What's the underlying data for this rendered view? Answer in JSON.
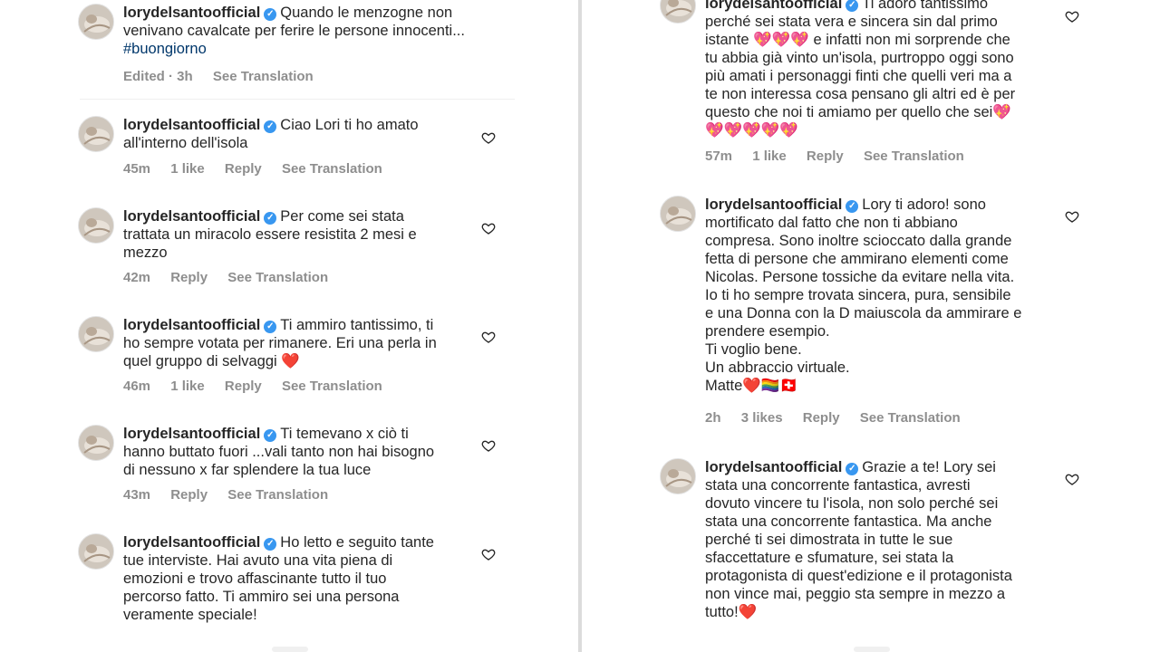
{
  "left": {
    "caption": {
      "username": "lorydelsantoofficial",
      "text": "Quando le menzogne non venivano cavalcate per ferire le persone innocenti...",
      "hashtag": "#buongiorno",
      "edited": "Edited · 3h",
      "translate": "See Translation"
    },
    "comments": [
      {
        "username": "lorydelsantoofficial",
        "line1": "Ciao Lori ti ho amato",
        "line2": "all'interno dell'isola",
        "time": "45m",
        "likes": "1 like",
        "reply": "Reply",
        "translate": "See Translation"
      },
      {
        "username": "lorydelsantoofficial",
        "line1": "Per come sei stata",
        "line2": "trattata un miracolo essere resistita 2 mesi e",
        "line3": "mezzo",
        "time": "42m",
        "reply": "Reply",
        "translate": "See Translation"
      },
      {
        "username": "lorydelsantoofficial",
        "line1": "Ti ammiro tantissimo, ti",
        "line2": "ho sempre votata per rimanere. Eri una perla in",
        "line3": "quel gruppo di selvaggi",
        "emoji": "❤️",
        "time": "46m",
        "likes": "1 like",
        "reply": "Reply",
        "translate": "See Translation"
      },
      {
        "username": "lorydelsantoofficial",
        "line1": "Ti temevano x ciò ti",
        "line2": "hanno buttato fuori ...vali tanto non hai bisogno",
        "line3": "di nessuno x far splendere la tua luce",
        "time": "43m",
        "reply": "Reply",
        "translate": "See Translation"
      },
      {
        "username": "lorydelsantoofficial",
        "line1": "Ho letto e seguito tante",
        "line2": "tue interviste. Hai avuto una vita piena di",
        "line3": "emozioni e trovo affascinante tutto il tuo",
        "line4": "percorso fatto. Ti ammiro sei una persona",
        "line5": "veramente speciale!"
      }
    ]
  },
  "right": {
    "comments": [
      {
        "username": "lorydelsantoofficial",
        "line1": "Ti adoro tantissimo",
        "line2": "perché sei stata vera e sincera sin dal primo",
        "line3": "istante",
        "line3b": "e infatti non mi sorprende che",
        "line4": "tu abbia già vinto un'isola, purtroppo oggi sono",
        "line5": "più amati i personaggi finti che quelli veri ma a",
        "line6": "te non interessa cosa pensano gli altri ed è per",
        "line7": "questo che noi ti amiamo per quello che sei",
        "hearts_a": "💖💖💖",
        "hearts_b": "💖",
        "hearts_c": "💖💖💖💖💖",
        "time": "57m",
        "likes": "1 like",
        "reply": "Reply",
        "translate": "See Translation"
      },
      {
        "username": "lorydelsantoofficial",
        "line1": "Lory ti adoro! sono",
        "line2": "mortificato dal fatto che non ti abbiano",
        "line3": "compresa. Sono inoltre scioccato dalla grande",
        "line4": "fetta di persone che ammirano elementi come",
        "line5": "Nicolas. Persone tossiche da evitare nella vita.",
        "line6": "Io ti ho sempre trovata sincera, pura, sensibile",
        "line7": "e una Donna con la D maiuscola da ammirare e",
        "line8": "prendere esempio.",
        "line9": "Ti voglio bene.",
        "line10": "Un abbraccio virtuale.",
        "line11": "Matte",
        "emojis": "❤️🏳️‍🌈🇨🇭",
        "time": "2h",
        "likes": "3 likes",
        "reply": "Reply",
        "translate": "See Translation"
      },
      {
        "username": "lorydelsantoofficial",
        "line1": "Grazie a te! Lory sei",
        "line2": "stata una concorrente fantastica, avresti",
        "line3": "dovuto vincere tu l'isola, non solo perché sei",
        "line4": "stata una concorrente fantastica. Ma anche",
        "line5": "perché ti sei dimostrata in tutte le sue",
        "line6": "sfaccettature e sfumature, sei stata la",
        "line7": "protagonista di quest'edizione e il protagonista",
        "line8": "non vince mai, peggio sta sempre in mezzo a",
        "line9": "tutto!",
        "emoji": "❤️"
      }
    ]
  }
}
